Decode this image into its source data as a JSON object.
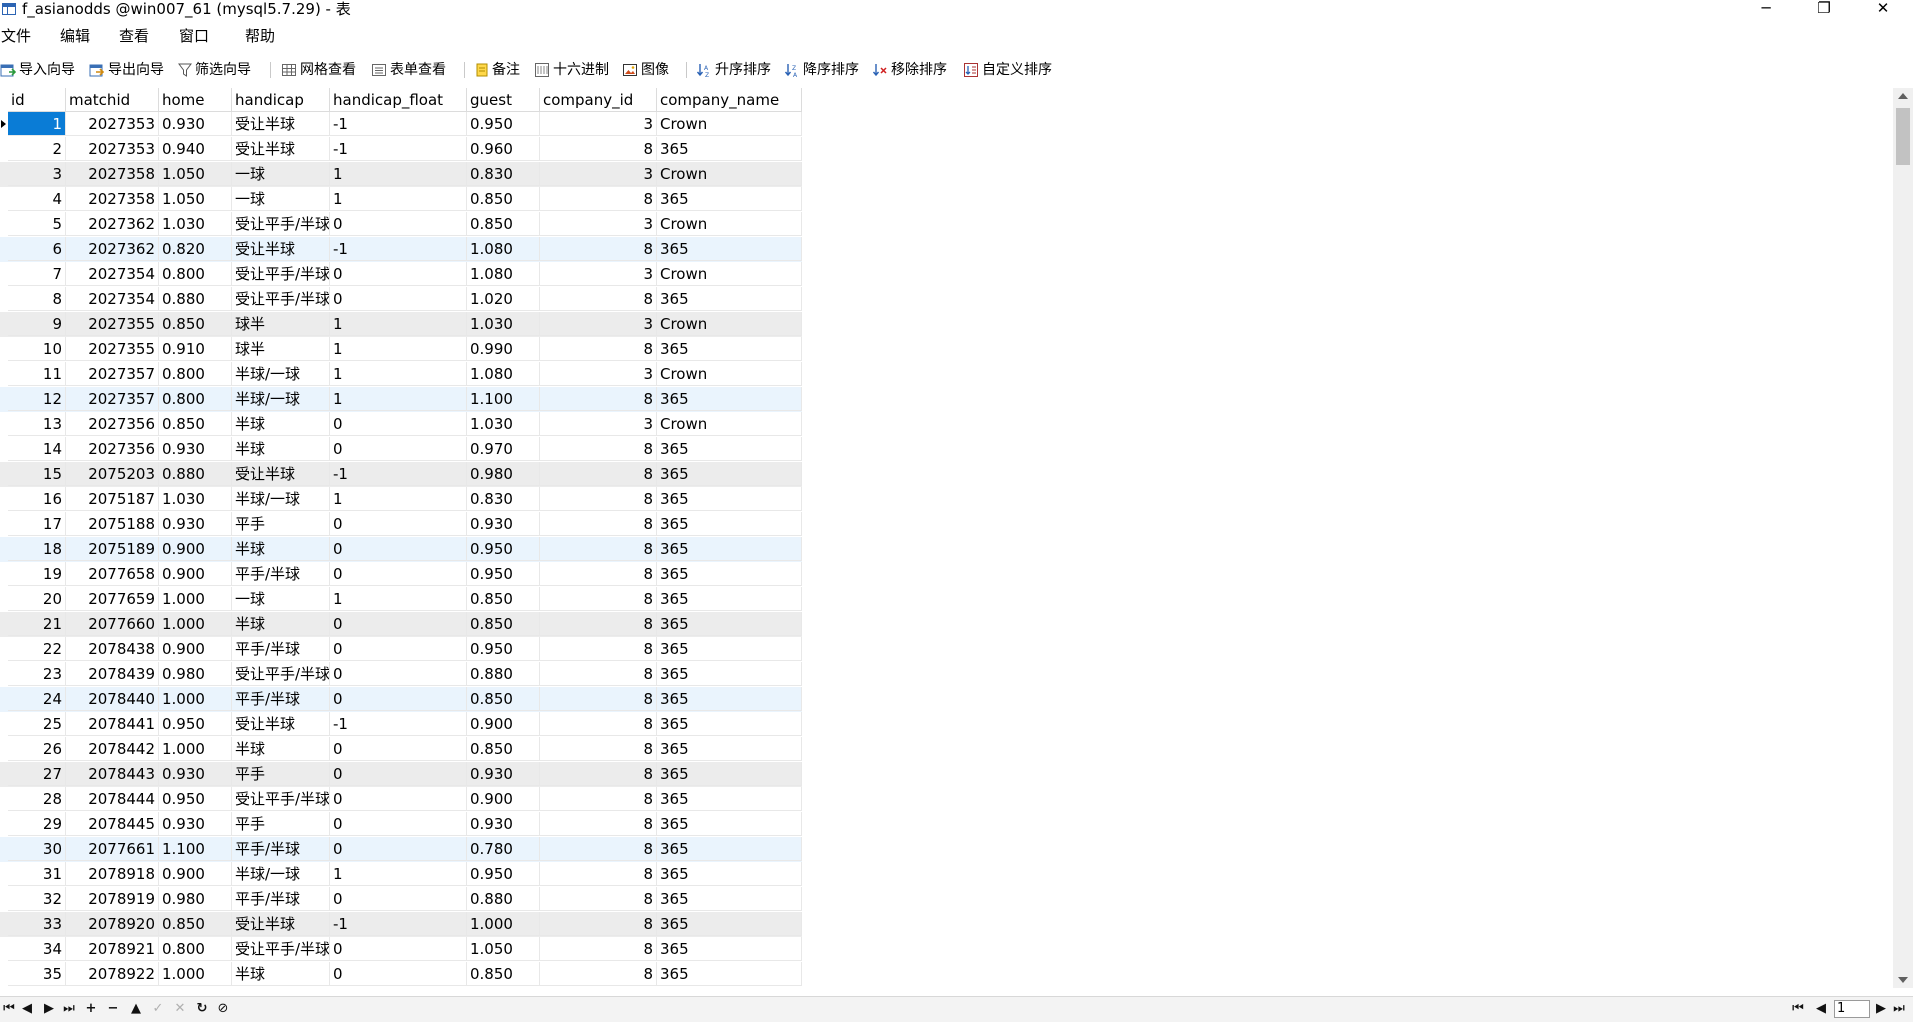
{
  "window": {
    "title": "f_asianodds @win007_61 (mysql5.7.29) - 表",
    "minimize_glyph": "─",
    "maximize_glyph": "❐",
    "close_glyph": "✕"
  },
  "menu": [
    "文件",
    "编辑",
    "查看",
    "窗口",
    "帮助"
  ],
  "toolbar": {
    "import_wizard": "导入向导",
    "export_wizard": "导出向导",
    "filter_wizard": "筛选向导",
    "grid_view": "网格查看",
    "form_view": "表单查看",
    "memo": "备注",
    "hex": "十六进制",
    "image": "图像",
    "sort_asc": "升序排序",
    "sort_desc": "降序排序",
    "remove_sort": "移除排序",
    "custom_sort": "自定义排序"
  },
  "columns": [
    "id",
    "matchid",
    "home",
    "handicap",
    "handicap_float",
    "guest",
    "company_id",
    "company_name"
  ],
  "rows": [
    {
      "id": "1",
      "matchid": "2027353",
      "home": "0.930",
      "handicap": "受让半球",
      "handicap_float": "-1",
      "guest": "0.950",
      "company_id": "3",
      "company_name": "Crown"
    },
    {
      "id": "2",
      "matchid": "2027353",
      "home": "0.940",
      "handicap": "受让半球",
      "handicap_float": "-1",
      "guest": "0.960",
      "company_id": "8",
      "company_name": "365"
    },
    {
      "id": "3",
      "matchid": "2027358",
      "home": "1.050",
      "handicap": "一球",
      "handicap_float": "1",
      "guest": "0.830",
      "company_id": "3",
      "company_name": "Crown"
    },
    {
      "id": "4",
      "matchid": "2027358",
      "home": "1.050",
      "handicap": "一球",
      "handicap_float": "1",
      "guest": "0.850",
      "company_id": "8",
      "company_name": "365"
    },
    {
      "id": "5",
      "matchid": "2027362",
      "home": "1.030",
      "handicap": "受让平手/半球",
      "handicap_float": "0",
      "guest": "0.850",
      "company_id": "3",
      "company_name": "Crown"
    },
    {
      "id": "6",
      "matchid": "2027362",
      "home": "0.820",
      "handicap": "受让半球",
      "handicap_float": "-1",
      "guest": "1.080",
      "company_id": "8",
      "company_name": "365"
    },
    {
      "id": "7",
      "matchid": "2027354",
      "home": "0.800",
      "handicap": "受让平手/半球",
      "handicap_float": "0",
      "guest": "1.080",
      "company_id": "3",
      "company_name": "Crown"
    },
    {
      "id": "8",
      "matchid": "2027354",
      "home": "0.880",
      "handicap": "受让平手/半球",
      "handicap_float": "0",
      "guest": "1.020",
      "company_id": "8",
      "company_name": "365"
    },
    {
      "id": "9",
      "matchid": "2027355",
      "home": "0.850",
      "handicap": "球半",
      "handicap_float": "1",
      "guest": "1.030",
      "company_id": "3",
      "company_name": "Crown"
    },
    {
      "id": "10",
      "matchid": "2027355",
      "home": "0.910",
      "handicap": "球半",
      "handicap_float": "1",
      "guest": "0.990",
      "company_id": "8",
      "company_name": "365"
    },
    {
      "id": "11",
      "matchid": "2027357",
      "home": "0.800",
      "handicap": "半球/一球",
      "handicap_float": "1",
      "guest": "1.080",
      "company_id": "3",
      "company_name": "Crown"
    },
    {
      "id": "12",
      "matchid": "2027357",
      "home": "0.800",
      "handicap": "半球/一球",
      "handicap_float": "1",
      "guest": "1.100",
      "company_id": "8",
      "company_name": "365"
    },
    {
      "id": "13",
      "matchid": "2027356",
      "home": "0.850",
      "handicap": "半球",
      "handicap_float": "0",
      "guest": "1.030",
      "company_id": "3",
      "company_name": "Crown"
    },
    {
      "id": "14",
      "matchid": "2027356",
      "home": "0.930",
      "handicap": "半球",
      "handicap_float": "0",
      "guest": "0.970",
      "company_id": "8",
      "company_name": "365"
    },
    {
      "id": "15",
      "matchid": "2075203",
      "home": "0.880",
      "handicap": "受让半球",
      "handicap_float": "-1",
      "guest": "0.980",
      "company_id": "8",
      "company_name": "365"
    },
    {
      "id": "16",
      "matchid": "2075187",
      "home": "1.030",
      "handicap": "半球/一球",
      "handicap_float": "1",
      "guest": "0.830",
      "company_id": "8",
      "company_name": "365"
    },
    {
      "id": "17",
      "matchid": "2075188",
      "home": "0.930",
      "handicap": "平手",
      "handicap_float": "0",
      "guest": "0.930",
      "company_id": "8",
      "company_name": "365"
    },
    {
      "id": "18",
      "matchid": "2075189",
      "home": "0.900",
      "handicap": "半球",
      "handicap_float": "0",
      "guest": "0.950",
      "company_id": "8",
      "company_name": "365"
    },
    {
      "id": "19",
      "matchid": "2077658",
      "home": "0.900",
      "handicap": "平手/半球",
      "handicap_float": "0",
      "guest": "0.950",
      "company_id": "8",
      "company_name": "365"
    },
    {
      "id": "20",
      "matchid": "2077659",
      "home": "1.000",
      "handicap": "一球",
      "handicap_float": "1",
      "guest": "0.850",
      "company_id": "8",
      "company_name": "365"
    },
    {
      "id": "21",
      "matchid": "2077660",
      "home": "1.000",
      "handicap": "半球",
      "handicap_float": "0",
      "guest": "0.850",
      "company_id": "8",
      "company_name": "365"
    },
    {
      "id": "22",
      "matchid": "2078438",
      "home": "0.900",
      "handicap": "平手/半球",
      "handicap_float": "0",
      "guest": "0.950",
      "company_id": "8",
      "company_name": "365"
    },
    {
      "id": "23",
      "matchid": "2078439",
      "home": "0.980",
      "handicap": "受让平手/半球",
      "handicap_float": "0",
      "guest": "0.880",
      "company_id": "8",
      "company_name": "365"
    },
    {
      "id": "24",
      "matchid": "2078440",
      "home": "1.000",
      "handicap": "平手/半球",
      "handicap_float": "0",
      "guest": "0.850",
      "company_id": "8",
      "company_name": "365"
    },
    {
      "id": "25",
      "matchid": "2078441",
      "home": "0.950",
      "handicap": "受让半球",
      "handicap_float": "-1",
      "guest": "0.900",
      "company_id": "8",
      "company_name": "365"
    },
    {
      "id": "26",
      "matchid": "2078442",
      "home": "1.000",
      "handicap": "半球",
      "handicap_float": "0",
      "guest": "0.850",
      "company_id": "8",
      "company_name": "365"
    },
    {
      "id": "27",
      "matchid": "2078443",
      "home": "0.930",
      "handicap": "平手",
      "handicap_float": "0",
      "guest": "0.930",
      "company_id": "8",
      "company_name": "365"
    },
    {
      "id": "28",
      "matchid": "2078444",
      "home": "0.950",
      "handicap": "受让平手/半球",
      "handicap_float": "0",
      "guest": "0.900",
      "company_id": "8",
      "company_name": "365"
    },
    {
      "id": "29",
      "matchid": "2078445",
      "home": "0.930",
      "handicap": "平手",
      "handicap_float": "0",
      "guest": "0.930",
      "company_id": "8",
      "company_name": "365"
    },
    {
      "id": "30",
      "matchid": "2077661",
      "home": "1.100",
      "handicap": "平手/半球",
      "handicap_float": "0",
      "guest": "0.780",
      "company_id": "8",
      "company_name": "365"
    },
    {
      "id": "31",
      "matchid": "2078918",
      "home": "0.900",
      "handicap": "半球/一球",
      "handicap_float": "1",
      "guest": "0.950",
      "company_id": "8",
      "company_name": "365"
    },
    {
      "id": "32",
      "matchid": "2078919",
      "home": "0.980",
      "handicap": "平手/半球",
      "handicap_float": "0",
      "guest": "0.880",
      "company_id": "8",
      "company_name": "365"
    },
    {
      "id": "33",
      "matchid": "2078920",
      "home": "0.850",
      "handicap": "受让半球",
      "handicap_float": "-1",
      "guest": "1.000",
      "company_id": "8",
      "company_name": "365"
    },
    {
      "id": "34",
      "matchid": "2078921",
      "home": "0.800",
      "handicap": "受让平手/半球",
      "handicap_float": "0",
      "guest": "1.050",
      "company_id": "8",
      "company_name": "365"
    },
    {
      "id": "35",
      "matchid": "2078922",
      "home": "1.000",
      "handicap": "半球",
      "handicap_float": "0",
      "guest": "0.850",
      "company_id": "8",
      "company_name": "365"
    }
  ],
  "row_shading": {
    "gray": [
      3,
      9,
      15,
      21,
      27,
      33
    ],
    "blue": [
      6,
      12,
      18,
      24,
      30
    ]
  },
  "selected_row": 1,
  "navigation": {
    "page": "1",
    "first_glyph": "⏮",
    "prev_glyph": "◀",
    "next_glyph": "▶",
    "last_glyph": "⏭",
    "add_glyph": "+",
    "delete_glyph": "−",
    "up_glyph": "▲",
    "apply_glyph": "✓",
    "cancel_glyph": "✕",
    "refresh_glyph": "↻",
    "stop_glyph": "⊘"
  },
  "colors": {
    "selection": "#0a7cd6",
    "gray_row": "#ececec",
    "blue_row": "#eaf4fd"
  }
}
